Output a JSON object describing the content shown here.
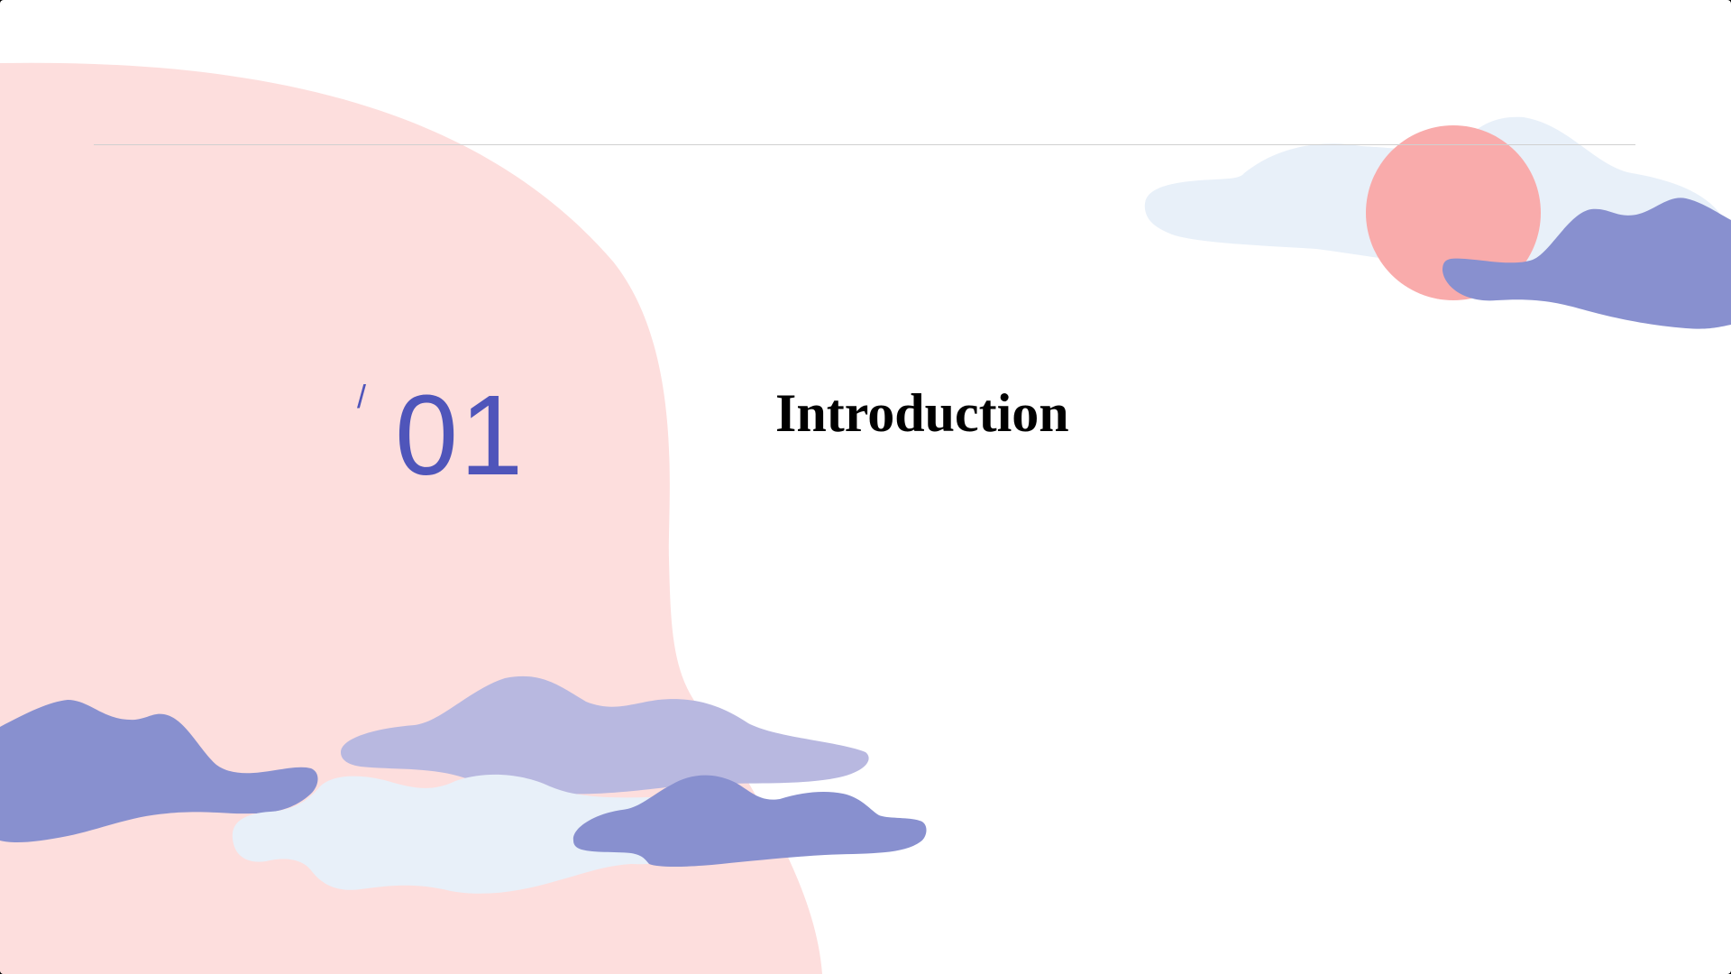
{
  "slide": {
    "slash": "/",
    "number": "01",
    "title": "Introduction"
  },
  "colors": {
    "background": "#ffffff",
    "blob_pink": "#fddedd",
    "sun": "#f9abab",
    "cloud_light": "#e8f0f9",
    "cloud_mid": "#b8b8e0",
    "cloud_dark": "#8890cf",
    "accent_text": "#4f55ba",
    "divider": "#d0d0d0"
  }
}
